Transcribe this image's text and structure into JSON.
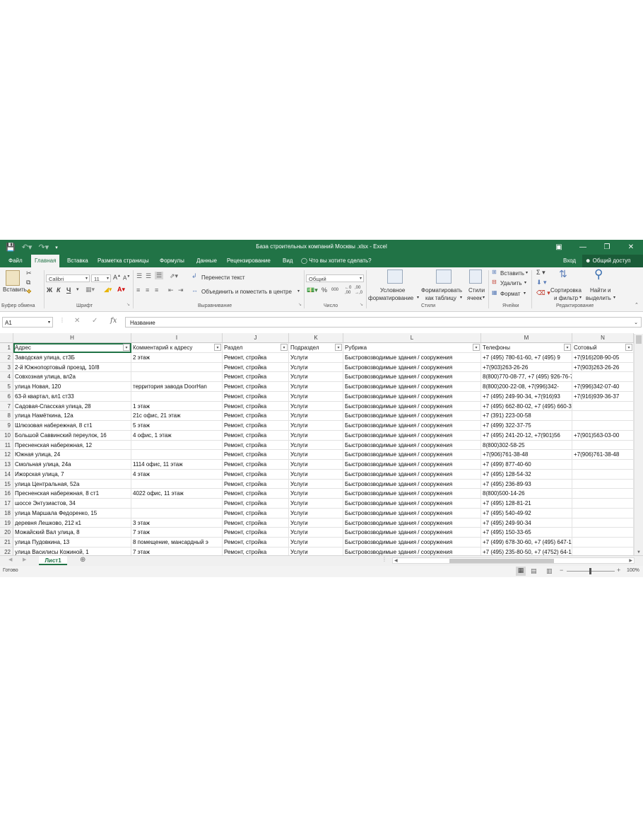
{
  "window": {
    "title": "База строительных компаний Москвы .xlsx - Excel"
  },
  "tabs": [
    "Файл",
    "Главная",
    "Вставка",
    "Разметка страницы",
    "Формулы",
    "Данные",
    "Рецензирование",
    "Вид"
  ],
  "tell_me": "Что вы хотите сделать?",
  "signin": "Вход",
  "share": "Общий доступ",
  "ribbon": {
    "paste": "Вставить",
    "clipboard_group": "Буфер обмена",
    "font_name": "Calibri",
    "font_size": "11",
    "font_group": "Шрифт",
    "wrap_text": "Перенести текст",
    "merge_center": "Объединить и поместить в центре",
    "alignment_group": "Выравнивание",
    "number_format": "Общий",
    "number_group": "Число",
    "cond_format_1": "Условное",
    "cond_format_2": "форматирование",
    "format_table_1": "Форматировать",
    "format_table_2": "как таблицу",
    "cell_styles_1": "Стили",
    "cell_styles_2": "ячеек",
    "styles_group": "Стили",
    "insert": "Вставить",
    "delete": "Удалить",
    "format": "Формат",
    "cells_group": "Ячейки",
    "sort_filter_1": "Сортировка",
    "sort_filter_2": "и фильтр",
    "find_select_1": "Найти и",
    "find_select_2": "выделить",
    "editing_group": "Редактирование"
  },
  "formula_bar": {
    "name_box": "A1",
    "formula": "Название"
  },
  "grid": {
    "columns": [
      "H",
      "I",
      "J",
      "K",
      "L",
      "M",
      "N"
    ],
    "headers": [
      "Адрес",
      "Комментарий к адресу",
      "Раздел",
      "Подраздел",
      "Рубрика",
      "Телефоны",
      "Сотовый"
    ],
    "rows": [
      {
        "num": "2",
        "cells": [
          "Заводская улица, ст3Б",
          "2 этаж",
          "Ремонт, стройка",
          "Услуги",
          "Быстровозводимые здания / сооружения",
          "+7 (495) 780-61-60, +7 (495) 9",
          "+7(916)208-90-05"
        ]
      },
      {
        "num": "3",
        "cells": [
          "2-й Южнопортовый проезд, 10/8",
          "",
          "Ремонт, стройка",
          "Услуги",
          "Быстровозводимые здания / сооружения",
          "+7(903)263-26-26",
          "+7(903)263-26-26"
        ]
      },
      {
        "num": "4",
        "cells": [
          "Совхозная улица, вл2а",
          "",
          "Ремонт, стройка",
          "Услуги",
          "Быстровозводимые здания / сооружения",
          "8(800)770-08-77, +7 (495) 926-76-76",
          ""
        ]
      },
      {
        "num": "5",
        "cells": [
          "улица Новая, 120",
          "территория завода DoorHan",
          "Ремонт, стройка",
          "Услуги",
          "Быстровозводимые здания / сооружения",
          "8(800)200-22-08, +7(996)342-",
          "+7(996)342-07-40"
        ]
      },
      {
        "num": "6",
        "cells": [
          "63-й квартал, вл1 ст33",
          "",
          "Ремонт, стройка",
          "Услуги",
          "Быстровозводимые здания / сооружения",
          "+7 (495) 249-90-34, +7(916)93",
          "+7(916)939-36-37"
        ]
      },
      {
        "num": "7",
        "cells": [
          "Садовая-Спасская улица, 28",
          "1 этаж",
          "Ремонт, стройка",
          "Услуги",
          "Быстровозводимые здания / сооружения",
          "+7 (495) 662-80-02, +7 (495) 660-30-30, +7 (495) 1",
          ""
        ]
      },
      {
        "num": "8",
        "cells": [
          "улица Намёткина, 12а",
          "21с офис, 21 этаж",
          "Ремонт, стройка",
          "Услуги",
          "Быстровозводимые здания / сооружения",
          "+7 (391) 223-00-58",
          ""
        ]
      },
      {
        "num": "9",
        "cells": [
          "Шлюзовая набережная, 8 ст1",
          "5 этаж",
          "Ремонт, стройка",
          "Услуги",
          "Быстровозводимые здания / сооружения",
          "+7 (499) 322-37-75",
          ""
        ]
      },
      {
        "num": "10",
        "cells": [
          "Большой Саввинский переулок, 16",
          "4 офис, 1 этаж",
          "Ремонт, стройка",
          "Услуги",
          "Быстровозводимые здания / сооружения",
          "+7 (495) 241-20-12, +7(901)56",
          "+7(901)563-03-00"
        ]
      },
      {
        "num": "11",
        "cells": [
          "Пресненская набережная, 12",
          "",
          "Ремонт, стройка",
          "Услуги",
          "Быстровозводимые здания / сооружения",
          "8(800)302-58-25",
          ""
        ]
      },
      {
        "num": "12",
        "cells": [
          "Южная улица, 24",
          "",
          "Ремонт, стройка",
          "Услуги",
          "Быстровозводимые здания / сооружения",
          "+7(906)761-38-48",
          "+7(906)761-38-48"
        ]
      },
      {
        "num": "13",
        "cells": [
          "Смольная улица, 24а",
          "1114 офис, 11 этаж",
          "Ремонт, стройка",
          "Услуги",
          "Быстровозводимые здания / сооружения",
          "+7 (499) 877-40-60",
          ""
        ]
      },
      {
        "num": "14",
        "cells": [
          "Ижорская улица, 7",
          "4 этаж",
          "Ремонт, стройка",
          "Услуги",
          "Быстровозводимые здания / сооружения",
          "+7 (495) 128-54-32",
          ""
        ]
      },
      {
        "num": "15",
        "cells": [
          "улица Центральная, 52а",
          "",
          "Ремонт, стройка",
          "Услуги",
          "Быстровозводимые здания / сооружения",
          "+7 (495) 236-89-93",
          ""
        ]
      },
      {
        "num": "16",
        "cells": [
          "Пресненская набережная, 8 ст1",
          "4022 офис, 11 этаж",
          "Ремонт, стройка",
          "Услуги",
          "Быстровозводимые здания / сооружения",
          "8(800)500-14-26",
          ""
        ]
      },
      {
        "num": "17",
        "cells": [
          "шоссе Энтузиастов, 34",
          "",
          "Ремонт, стройка",
          "Услуги",
          "Быстровозводимые здания / сооружения",
          "+7 (495) 128-81-21",
          ""
        ]
      },
      {
        "num": "18",
        "cells": [
          "улица Маршала Федоренко, 15",
          "",
          "Ремонт, стройка",
          "Услуги",
          "Быстровозводимые здания / сооружения",
          "+7 (495) 540-49-92",
          ""
        ]
      },
      {
        "num": "19",
        "cells": [
          "деревня Лешково, 212 к1",
          "3 этаж",
          "Ремонт, стройка",
          "Услуги",
          "Быстровозводимые здания / сооружения",
          "+7 (495) 249-90-34",
          ""
        ]
      },
      {
        "num": "20",
        "cells": [
          "Можайский Вал улица, 8",
          "7 этаж",
          "Ремонт, стройка",
          "Услуги",
          "Быстровозводимые здания / сооружения",
          "+7 (495) 150-33-65",
          ""
        ]
      },
      {
        "num": "21",
        "cells": [
          "улица Пудовкина, 13",
          "8 помещение, мансардный э",
          "Ремонт, стройка",
          "Услуги",
          "Быстровозводимые здания / сооружения",
          "+7 (499) 678-30-60, +7 (495) 647-10-78",
          ""
        ]
      },
      {
        "num": "22",
        "cells": [
          "улица Василисы Кожиной, 1",
          "7 этаж",
          "Ремонт, стройка",
          "Услуги",
          "Быстровозводимые здания / сооружения",
          "+7 (495) 235-80-50, +7 (4752) 64-11-77",
          ""
        ]
      }
    ]
  },
  "sheet": {
    "tab": "Лист1"
  },
  "status": {
    "ready": "Готово",
    "zoom": "100%"
  },
  "colors": {
    "accent": "#217346"
  }
}
